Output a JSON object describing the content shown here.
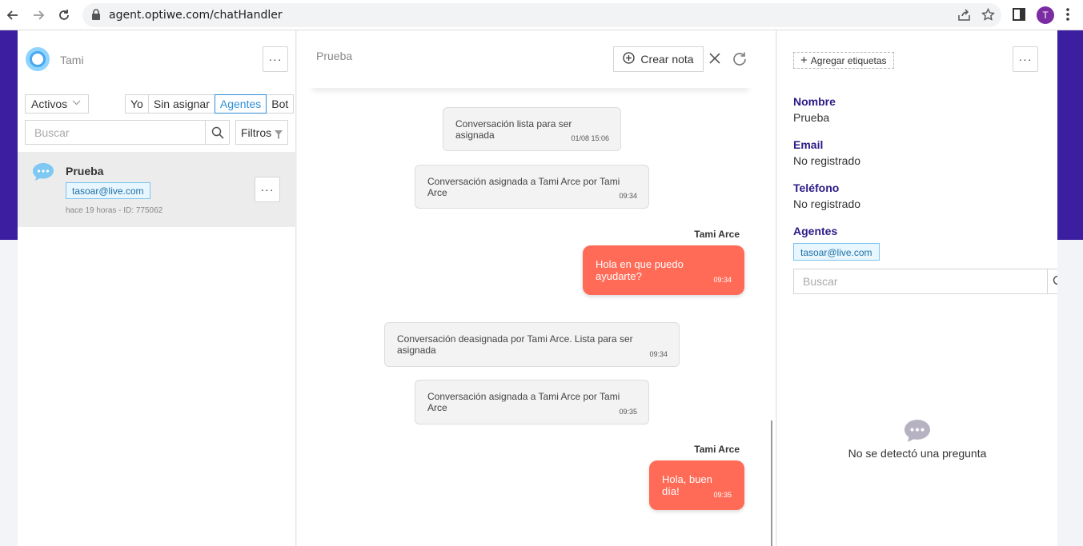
{
  "browser": {
    "url": "agent.optiwe.com/chatHandler",
    "profile_initial": "T",
    "icons": [
      "back-arrow-icon",
      "forward-arrow-icon",
      "reload-icon",
      "lock-icon",
      "share-icon",
      "star-icon",
      "side-panel-icon",
      "kebab-menu-icon"
    ]
  },
  "left": {
    "agent_name": "Tami",
    "menu_label": "···",
    "status_filter": "Activos",
    "assign_filters": [
      {
        "label": "Yo",
        "active": false
      },
      {
        "label": "Sin asignar",
        "active": false
      },
      {
        "label": "Agentes",
        "active": true
      },
      {
        "label": "Bot",
        "active": false
      }
    ],
    "search_placeholder": "Buscar",
    "filters_label": "Filtros",
    "conversation": {
      "title": "Prueba",
      "tag": "tasoar@live.com",
      "meta": "hace 19 horas - ID: 775062",
      "menu_label": "···"
    }
  },
  "middle": {
    "title": "Prueba",
    "create_note_label": "Crear nota",
    "messages": [
      {
        "kind": "system",
        "text": "Conversación lista para ser asignada",
        "time": "01/08 15:06"
      },
      {
        "kind": "system",
        "text": "Conversación asignada a Tami Arce por Tami Arce",
        "time": "09:34"
      },
      {
        "kind": "agent",
        "sender": "Tami Arce",
        "text": "Hola en que puedo ayudarte?",
        "time": "09:34"
      },
      {
        "kind": "system",
        "text": "Conversación deasignada por Tami Arce. Lista para ser asignada",
        "time": "09:34"
      },
      {
        "kind": "system",
        "text": "Conversación asignada a Tami Arce por Tami Arce",
        "time": "09:35"
      },
      {
        "kind": "agent",
        "sender": "Tami Arce",
        "text": "Hola, buen día!",
        "time": "09:35"
      }
    ]
  },
  "right": {
    "add_tags_label": "Agregar etiquetas",
    "menu_label": "···",
    "fields": [
      {
        "label": "Nombre",
        "value": "Prueba"
      },
      {
        "label": "Email",
        "value": "No registrado"
      },
      {
        "label": "Teléfono",
        "value": "No registrado"
      }
    ],
    "agents_label": "Agentes",
    "agent_tag": "tasoar@live.com",
    "search_placeholder": "Buscar",
    "empty_message": "No se detectó una pregunta"
  },
  "colors": {
    "brand_purple": "#3c1fa0",
    "label_purple": "#2c1a86",
    "agent_bubble": "#ff6b57",
    "accent_blue": "#2f8fd8"
  }
}
